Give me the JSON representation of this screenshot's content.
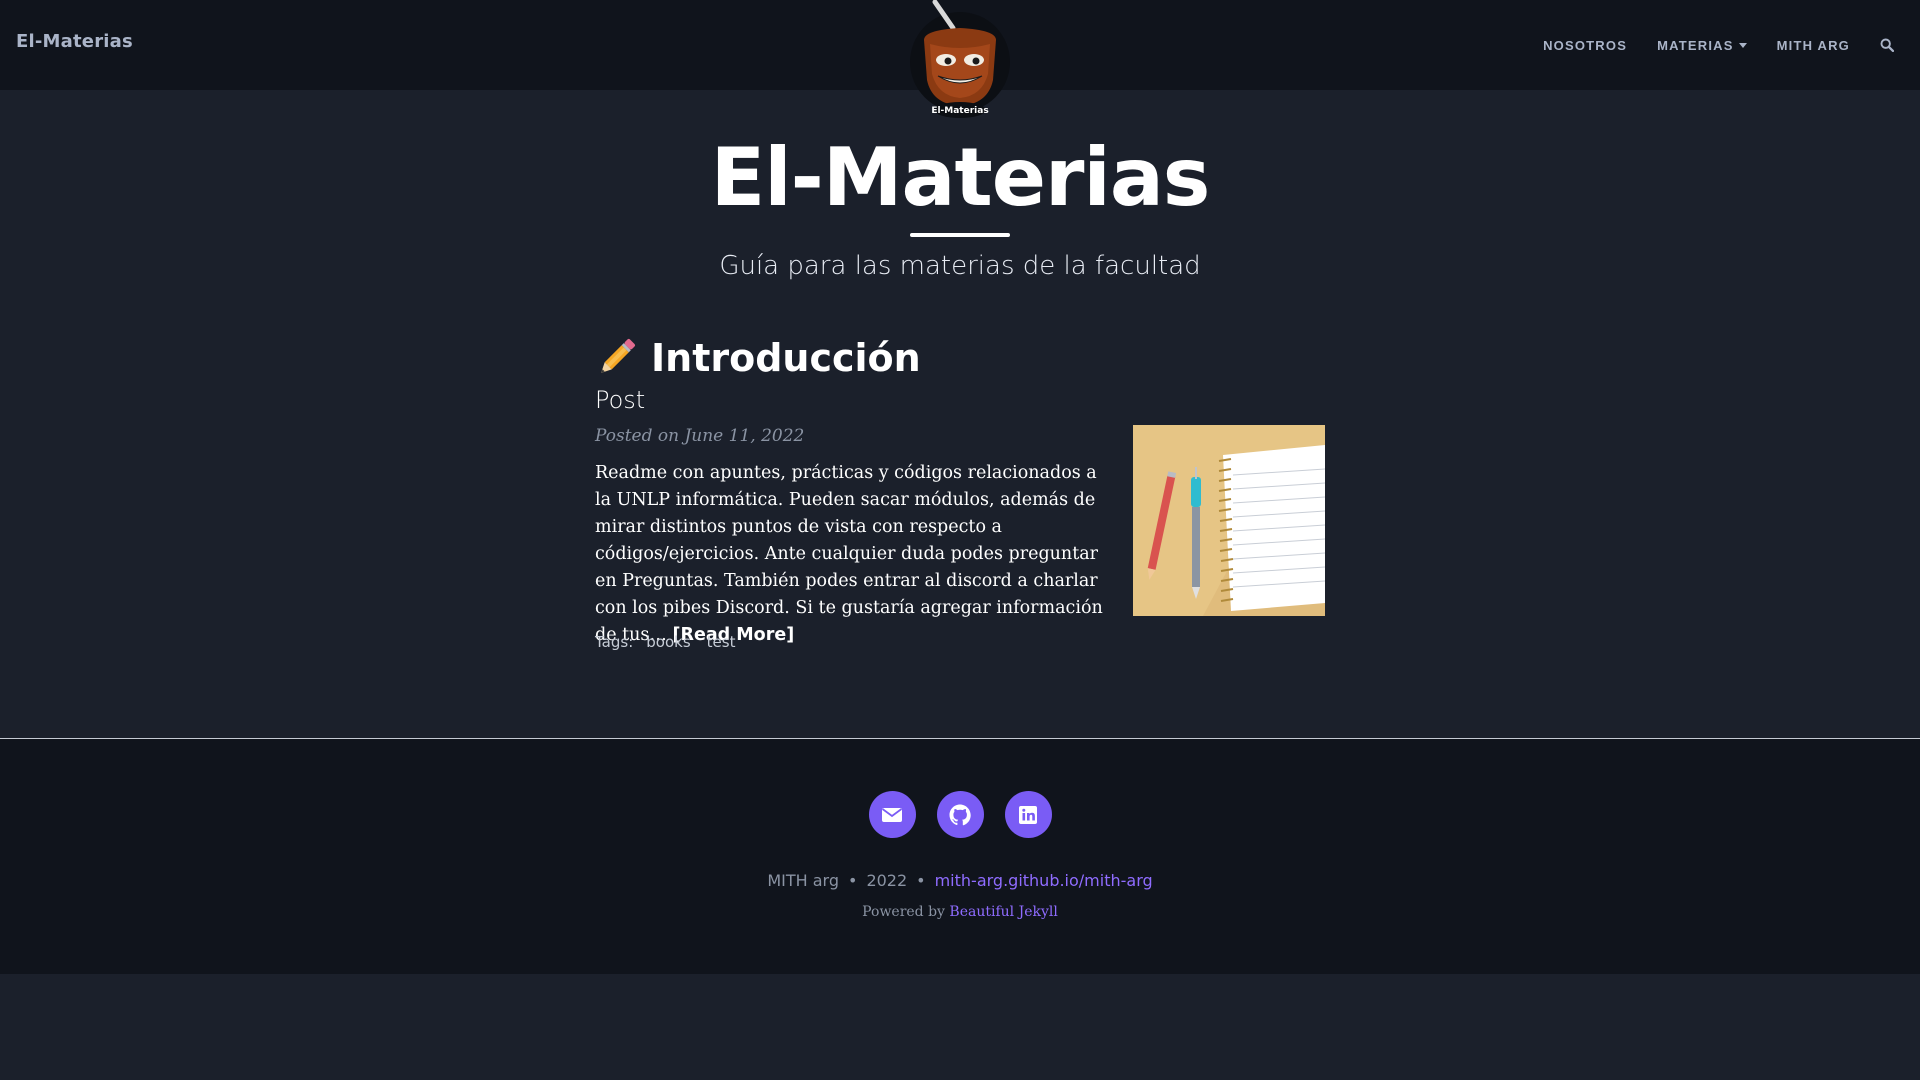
{
  "navbar": {
    "brand": "El-Materias",
    "links": [
      "NOSOTROS",
      "MATERIAS",
      "MITH ARG"
    ]
  },
  "header": {
    "title": "El-Materias",
    "subtitle": "Guía para las materias de la facultad",
    "avatar_text": "El-Materias"
  },
  "post": {
    "title": "Introducción",
    "subtitle": "Post",
    "meta": "Posted on June 11, 2022",
    "excerpt": "Readme con apuntes, prácticas y códigos relacionados a la UNLP informática. Pueden sacar módulos, además de mirar distintos puntos de vista con respecto a códigos/ejercicios. Ante cualquier duda podes preguntar en Preguntas. También podes entrar al discord a charlar con los pibes Discord. Si te gustaría agregar información de tus…",
    "read_more": "[Read More]",
    "tags_label": "Tags:",
    "tags": [
      "books",
      "test"
    ]
  },
  "footer": {
    "social": [
      "envelope-icon",
      "github-icon",
      "linkedin-icon"
    ],
    "author": "MITH arg",
    "year": "2022",
    "site": "mith-arg.github.io/mith-arg",
    "powered_by": "Powered by",
    "theme": "Beautiful Jekyll"
  },
  "colors": {
    "navbar_bg": "#10141c",
    "page_bg": "#1b202b",
    "nav_text": "#aab4c8",
    "accent": "#7a5cf5",
    "link": "#8f6cff"
  }
}
